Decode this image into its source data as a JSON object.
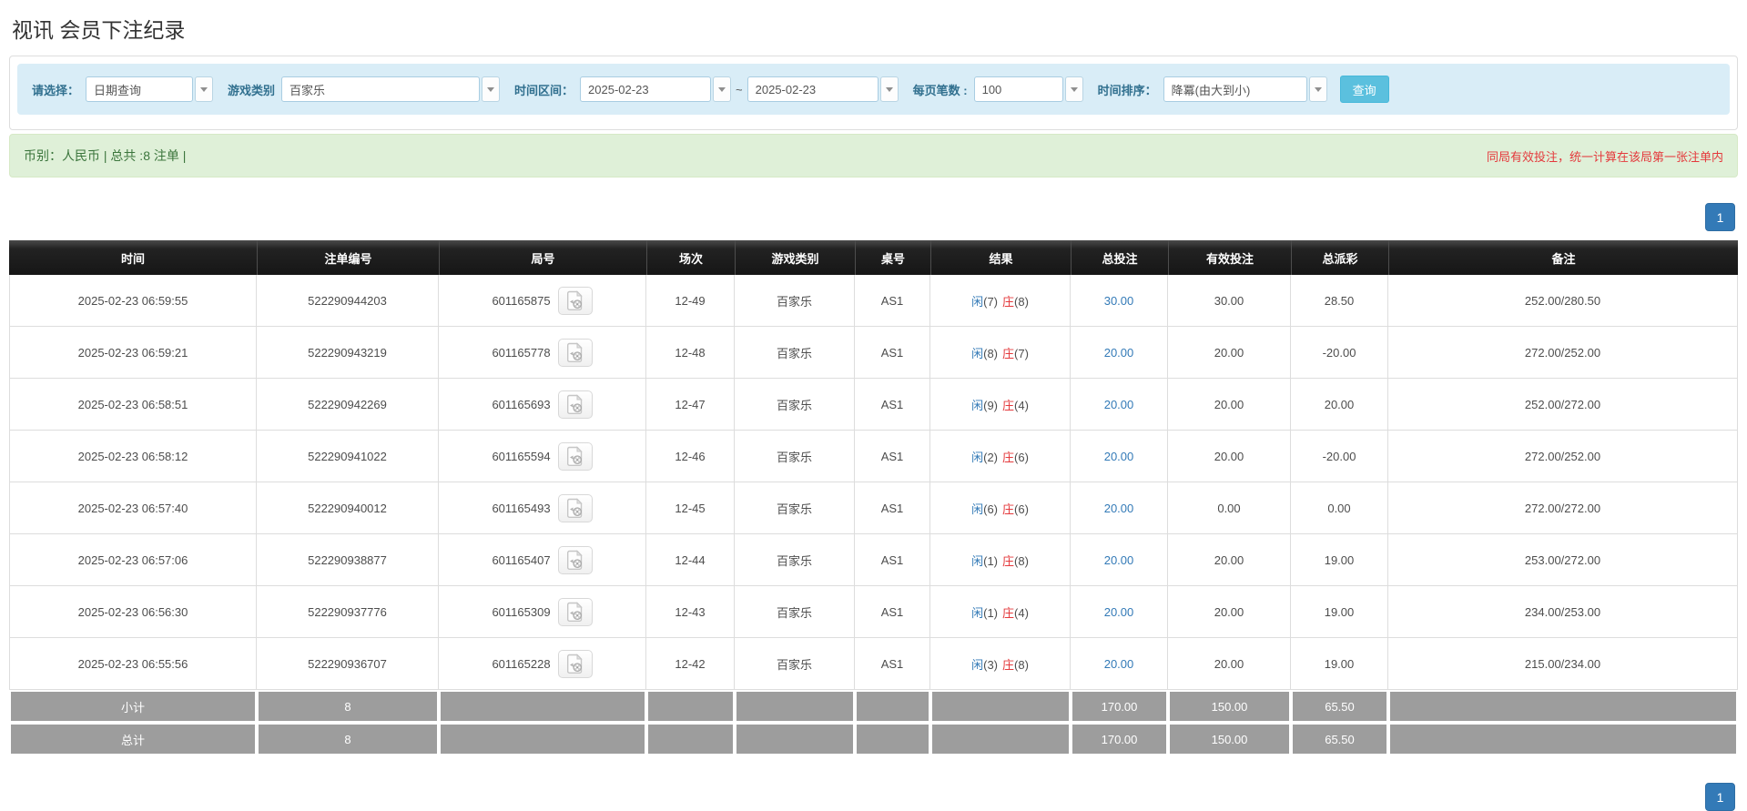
{
  "page": {
    "title": "视讯 会员下注纪录"
  },
  "filters": {
    "select_label": "请选择：",
    "select_value": "日期查询",
    "game_label": "游戏类别",
    "game_value": "百家乐",
    "range_label": "时间区间：",
    "date_from": "2025-02-23",
    "tilde": "~",
    "date_to": "2025-02-23",
    "page_size_label": "每页笔数 :",
    "page_size_value": "100",
    "sort_label": "时间排序：",
    "sort_value": "降冪(由大到小)",
    "search_button": "查询"
  },
  "summary": {
    "left": "币别：人民币 | 总共 :8 注单 |",
    "right": "同局有效投注，统一计算在该局第一张注单内"
  },
  "pagination": {
    "page": "1"
  },
  "icons": {
    "dropdown_caret": "chevron-down",
    "video_replay": "video-film-file"
  },
  "colors": {
    "header_bg": "#1f1f1f",
    "link_blue": "#337ab7",
    "player_blue": "#337ab7",
    "banker_red": "#e4393c",
    "negative_red": "#e4393c",
    "summary_bg": "#dff0d8",
    "summary_text": "#3c763d",
    "filter_bg": "#d9edf7",
    "filter_label": "#31708f",
    "search_button_bg": "#5bc0de",
    "pager_bg": "#337ab7",
    "totals_bg": "#9d9d9d"
  },
  "table": {
    "headers": [
      "时间",
      "注单编号",
      "局号",
      "场次",
      "游戏类别",
      "桌号",
      "结果",
      "总投注",
      "有效投注",
      "总派彩",
      "备注"
    ],
    "rows": [
      {
        "time": "2025-02-23 06:59:55",
        "bet_id": "522290944203",
        "round_id": "601165875",
        "session": "12-49",
        "game": "百家乐",
        "table_no": "AS1",
        "result_player": "闲",
        "result_player_score": "(7)",
        "result_banker": "庄",
        "result_banker_score": "(8)",
        "total_bet": "30.00",
        "valid_bet": "30.00",
        "payout": "28.50",
        "note": "252.00/280.50"
      },
      {
        "time": "2025-02-23 06:59:21",
        "bet_id": "522290943219",
        "round_id": "601165778",
        "session": "12-48",
        "game": "百家乐",
        "table_no": "AS1",
        "result_player": "闲",
        "result_player_score": "(8)",
        "result_banker": "庄",
        "result_banker_score": "(7)",
        "total_bet": "20.00",
        "valid_bet": "20.00",
        "payout": "-20.00",
        "note": "272.00/252.00"
      },
      {
        "time": "2025-02-23 06:58:51",
        "bet_id": "522290942269",
        "round_id": "601165693",
        "session": "12-47",
        "game": "百家乐",
        "table_no": "AS1",
        "result_player": "闲",
        "result_player_score": "(9)",
        "result_banker": "庄",
        "result_banker_score": "(4)",
        "total_bet": "20.00",
        "valid_bet": "20.00",
        "payout": "20.00",
        "note": "252.00/272.00"
      },
      {
        "time": "2025-02-23 06:58:12",
        "bet_id": "522290941022",
        "round_id": "601165594",
        "session": "12-46",
        "game": "百家乐",
        "table_no": "AS1",
        "result_player": "闲",
        "result_player_score": "(2)",
        "result_banker": "庄",
        "result_banker_score": "(6)",
        "total_bet": "20.00",
        "valid_bet": "20.00",
        "payout": "-20.00",
        "note": "272.00/252.00"
      },
      {
        "time": "2025-02-23 06:57:40",
        "bet_id": "522290940012",
        "round_id": "601165493",
        "session": "12-45",
        "game": "百家乐",
        "table_no": "AS1",
        "result_player": "闲",
        "result_player_score": "(6)",
        "result_banker": "庄",
        "result_banker_score": "(6)",
        "total_bet": "20.00",
        "valid_bet": "0.00",
        "payout": "0.00",
        "note": "272.00/272.00"
      },
      {
        "time": "2025-02-23 06:57:06",
        "bet_id": "522290938877",
        "round_id": "601165407",
        "session": "12-44",
        "game": "百家乐",
        "table_no": "AS1",
        "result_player": "闲",
        "result_player_score": "(1)",
        "result_banker": "庄",
        "result_banker_score": "(8)",
        "total_bet": "20.00",
        "valid_bet": "20.00",
        "payout": "19.00",
        "note": "253.00/272.00"
      },
      {
        "time": "2025-02-23 06:56:30",
        "bet_id": "522290937776",
        "round_id": "601165309",
        "session": "12-43",
        "game": "百家乐",
        "table_no": "AS1",
        "result_player": "闲",
        "result_player_score": "(1)",
        "result_banker": "庄",
        "result_banker_score": "(4)",
        "total_bet": "20.00",
        "valid_bet": "20.00",
        "payout": "19.00",
        "note": "234.00/253.00"
      },
      {
        "time": "2025-02-23 06:55:56",
        "bet_id": "522290936707",
        "round_id": "601165228",
        "session": "12-42",
        "game": "百家乐",
        "table_no": "AS1",
        "result_player": "闲",
        "result_player_score": "(3)",
        "result_banker": "庄",
        "result_banker_score": "(8)",
        "total_bet": "20.00",
        "valid_bet": "20.00",
        "payout": "19.00",
        "note": "215.00/234.00"
      }
    ],
    "subtotal": {
      "label": "小计",
      "count": "8",
      "total_bet": "170.00",
      "valid_bet": "150.00",
      "payout": "65.50"
    },
    "total": {
      "label": "总计",
      "count": "8",
      "total_bet": "170.00",
      "valid_bet": "150.00",
      "payout": "65.50"
    }
  }
}
